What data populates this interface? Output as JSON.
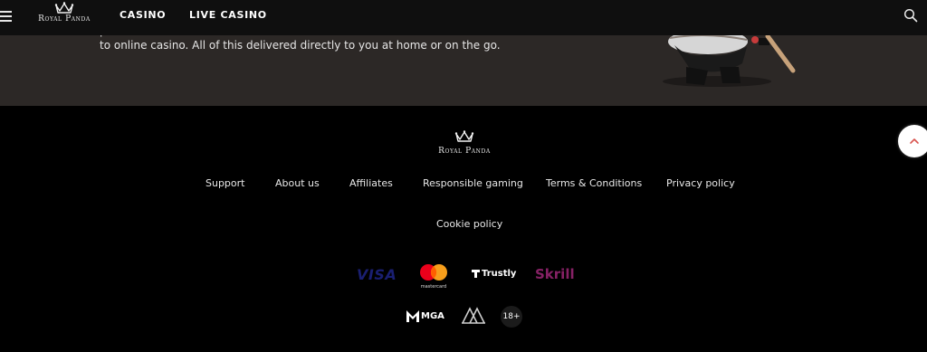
{
  "header": {
    "logo_text": "Royal Panda",
    "nav": [
      "CASINO",
      "LIVE CASINO"
    ]
  },
  "promo": {
    "line1": "p",
    "line2": "to online casino. All of this delivered directly to you at home or on the go."
  },
  "footer": {
    "logo_text": "Royal Panda",
    "links": [
      "Support",
      "About us",
      "Affiliates",
      "Responsible gaming",
      "Terms & Conditions",
      "Privacy policy"
    ],
    "cookie_link": "Cookie policy",
    "payments": {
      "visa": "VISA",
      "mastercard": "mastercard",
      "trustly": "Trustly",
      "skrill": "Skrill"
    },
    "licenses": {
      "mga": "MGA",
      "ga": "GA",
      "age": "18+"
    }
  },
  "colors": {
    "header_bg": "#0f0f0f",
    "promo_bg": "#2c2826",
    "footer_bg": "#000000",
    "visa": "#1a1f71",
    "skrill": "#862165",
    "scroll_top_arrow": "#d9544f"
  },
  "icons": [
    "menu-icon",
    "crown-icon",
    "search-icon",
    "chevron-up-icon"
  ]
}
